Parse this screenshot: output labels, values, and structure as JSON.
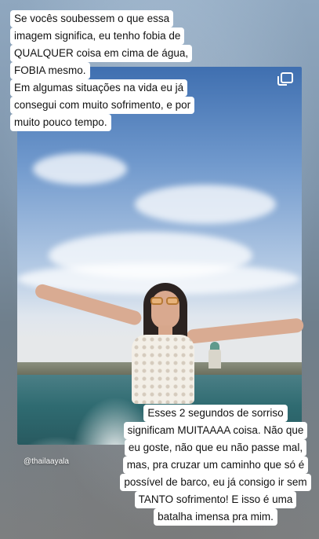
{
  "story": {
    "watermark": "@thailaayala",
    "multi_icon": "multiple-photos-icon"
  },
  "captions": {
    "top": [
      "Se vocês soubessem o que essa",
      "imagem significa, eu tenho fobia de",
      "QUALQUER coisa em cima de água,",
      "FOBIA mesmo.",
      "Em algumas situações na vida eu já",
      "consegui com muito sofrimento, e por",
      "muito pouco tempo."
    ],
    "bottom": [
      "Esses 2 segundos de sorriso",
      "significam MUITAAAA coisa. Não que",
      "eu goste, não que eu não passe mal,",
      "mas, pra cruzar um caminho que só é",
      "possível de barco, eu já consigo ir sem",
      "TANTO sofrimento! E isso é uma",
      "batalha imensa pra mim."
    ]
  }
}
